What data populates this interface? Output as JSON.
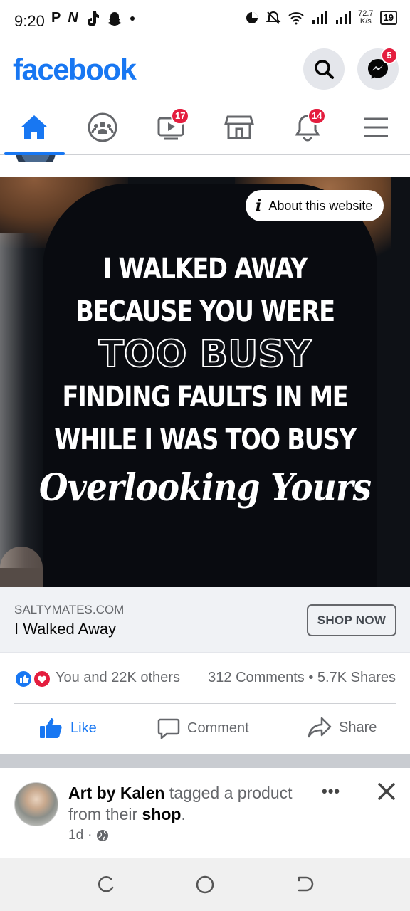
{
  "status_bar": {
    "time": "9:20",
    "left_icons": [
      "P",
      "N"
    ],
    "speed_value": "72.7",
    "speed_unit": "K/s",
    "battery": "19"
  },
  "header": {
    "logo": "facebook",
    "messenger_badge": "5"
  },
  "nav": {
    "tabs": [
      {
        "name": "home",
        "active": true
      },
      {
        "name": "groups"
      },
      {
        "name": "watch",
        "badge": "17"
      },
      {
        "name": "marketplace"
      },
      {
        "name": "notifications",
        "badge": "14"
      },
      {
        "name": "menu"
      }
    ]
  },
  "ad": {
    "about_label": "About this website",
    "lines": [
      "I WALKED AWAY",
      "BECAUSE YOU WERE",
      "TOO BUSY",
      "FINDING FAULTS IN ME",
      "WHILE I WAS TOO BUSY",
      "Overlooking Yours"
    ]
  },
  "link": {
    "domain": "SALTYMATES.COM",
    "title": "I Walked Away",
    "cta": "SHOP NOW"
  },
  "stats": {
    "reactions": "You and 22K others",
    "comments": "312 Comments",
    "separator": "•",
    "shares": "5.7K Shares"
  },
  "actions": {
    "like": "Like",
    "comment": "Comment",
    "share": "Share"
  },
  "next_post": {
    "author": "Art by Kalen",
    "tagged_text": "tagged a product from their",
    "shop_word": "shop",
    "end": ".",
    "time": "1d",
    "dot": "·",
    "more": "•••"
  },
  "colors": {
    "brand": "#1877f2",
    "badge": "#e41e3f",
    "secondary_text": "#65676b",
    "link_box_bg": "#f0f2f5"
  }
}
